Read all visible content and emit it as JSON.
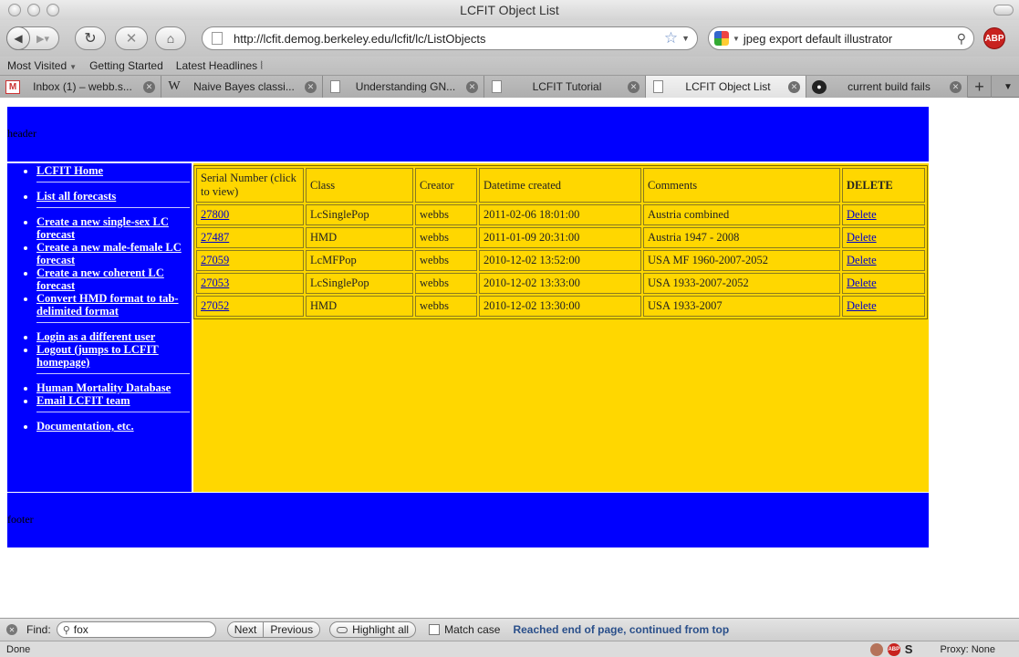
{
  "window": {
    "title": "LCFIT Object List"
  },
  "nav": {
    "url": "http://lcfit.demog.berkeley.edu/lcfit/lc/ListObjects",
    "search_query": "jpeg export default illustrator",
    "abp_label": "ABP"
  },
  "bookmarks": [
    {
      "label": "Most Visited"
    },
    {
      "label": "Getting Started"
    },
    {
      "label": "Latest Headlines"
    }
  ],
  "tabs": [
    {
      "label": "Inbox (1) – webb.s...",
      "icon": "gmail-icon"
    },
    {
      "label": "Naive Bayes classi...",
      "icon": "wikipedia-icon"
    },
    {
      "label": "Understanding GN...",
      "icon": "page-icon"
    },
    {
      "label": "LCFIT Tutorial",
      "icon": "page-icon"
    },
    {
      "label": "LCFIT Object List",
      "icon": "page-icon",
      "active": true
    },
    {
      "label": "current build fails",
      "icon": "github-icon"
    }
  ],
  "page": {
    "header_text": "header",
    "footer_text": "footer",
    "sidebar": {
      "groups": [
        [
          "LCFIT Home"
        ],
        [
          "List all forecasts"
        ],
        [
          "Create a new single-sex LC forecast",
          "Create a new male-female LC forecast",
          "Create a new coherent LC forecast",
          "Convert HMD format to tab-delimited format"
        ],
        [
          "Login as a different user",
          "Logout (jumps to LCFIT homepage)"
        ],
        [
          "Human Mortality Database",
          "Email LCFIT team"
        ],
        [
          "Documentation, etc."
        ]
      ]
    },
    "table": {
      "headers": [
        "Serial Number (click to view)",
        "Class",
        "Creator",
        "Datetime created",
        "Comments",
        "DELETE"
      ],
      "rows": [
        {
          "serial": "27800",
          "class": "LcSinglePop",
          "creator": "webbs",
          "datetime": "2011-02-06 18:01:00",
          "comments": "Austria combined",
          "delete": "Delete"
        },
        {
          "serial": "27487",
          "class": "HMD",
          "creator": "webbs",
          "datetime": "2011-01-09 20:31:00",
          "comments": "Austria 1947 - 2008",
          "delete": "Delete"
        },
        {
          "serial": "27059",
          "class": "LcMFPop",
          "creator": "webbs",
          "datetime": "2010-12-02 13:52:00",
          "comments": "USA MF 1960-2007-2052",
          "delete": "Delete"
        },
        {
          "serial": "27053",
          "class": "LcSinglePop",
          "creator": "webbs",
          "datetime": "2010-12-02 13:33:00",
          "comments": "USA 1933-2007-2052",
          "delete": "Delete"
        },
        {
          "serial": "27052",
          "class": "HMD",
          "creator": "webbs",
          "datetime": "2010-12-02 13:30:00",
          "comments": "USA 1933-2007",
          "delete": "Delete"
        }
      ]
    },
    "colors": {
      "header_footer": "#0000ff",
      "main": "#ffd700"
    }
  },
  "findbar": {
    "label": "Find:",
    "value": "fox",
    "next": "Next",
    "previous": "Previous",
    "highlight_all": "Highlight all",
    "match_case": "Match case",
    "status": "Reached end of page, continued from top"
  },
  "statusbar": {
    "text": "Done",
    "proxy": "Proxy: None"
  }
}
